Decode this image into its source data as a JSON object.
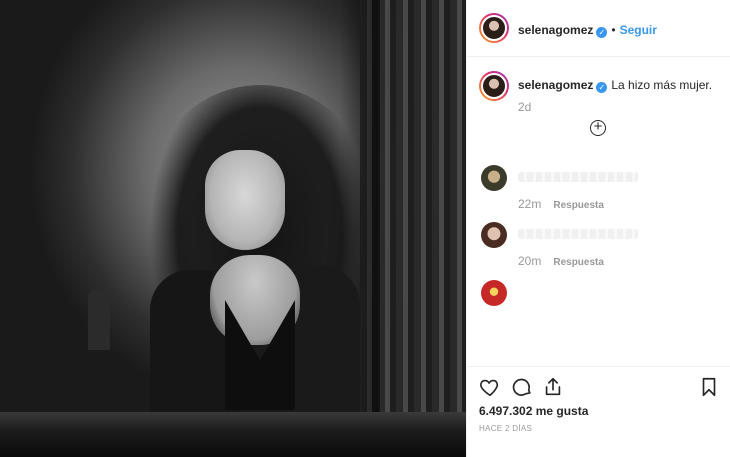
{
  "header": {
    "username": "selenagomez",
    "separator": "•",
    "follow_label": "Seguir"
  },
  "caption": {
    "username": "selenagomez",
    "text": "La hizo más mujer.",
    "time": "2d"
  },
  "load_more_symbol": "+",
  "comments": [
    {
      "time": "22m",
      "reply_label": "Respuesta"
    },
    {
      "time": "20m",
      "reply_label": "Respuesta"
    },
    {
      "time": "",
      "reply_label": ""
    }
  ],
  "actions": {
    "icons": [
      "heart-icon",
      "comment-icon",
      "share-icon",
      "bookmark-icon"
    ]
  },
  "likes": "6.497.302 me gusta",
  "posted_ago": "HACE 2 DÍAS",
  "colors": {
    "link_blue": "#3897f0",
    "text_dark": "#262626",
    "text_muted": "#999999",
    "divider": "#efefef"
  }
}
